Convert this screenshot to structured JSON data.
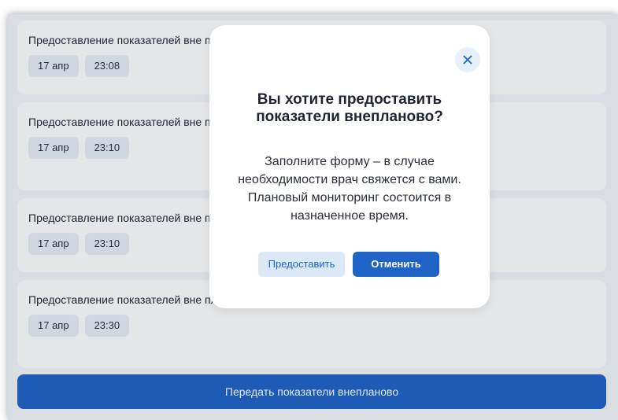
{
  "list": {
    "items": [
      {
        "title": "Предоставление показателей вне плана по программе наблюдения",
        "date": "17 апр",
        "time": "23:08"
      },
      {
        "title": "Предоставление показателей вне плана по программе беременности \"Быть мамой\"",
        "date": "17 апр",
        "time": "23:10"
      },
      {
        "title": "Предоставление показателей вне плана по программе наблюдения",
        "date": "17 апр",
        "time": "23:10"
      },
      {
        "title": "Предоставление показателей вне плана по программе наблюдения \"Быть мамой\"",
        "date": "17 апр",
        "time": "23:30"
      }
    ]
  },
  "bottom_button": {
    "label": "Передать показатели внепланово"
  },
  "modal": {
    "close_icon": "close-icon",
    "title": "Вы хотите предоставить показатели внепланово?",
    "body": "Заполните форму – в случае необходимости врач свяжется с вами. Плановый мониторинг состоится в назначенное время.",
    "provide_label": "Предоставить",
    "cancel_label": "Отменить"
  },
  "colors": {
    "primary": "#1f63c7",
    "secondary_button_bg": "#dbe8f8",
    "chip_bg": "#e9eef5",
    "page_bg": "#f3f6fa"
  }
}
